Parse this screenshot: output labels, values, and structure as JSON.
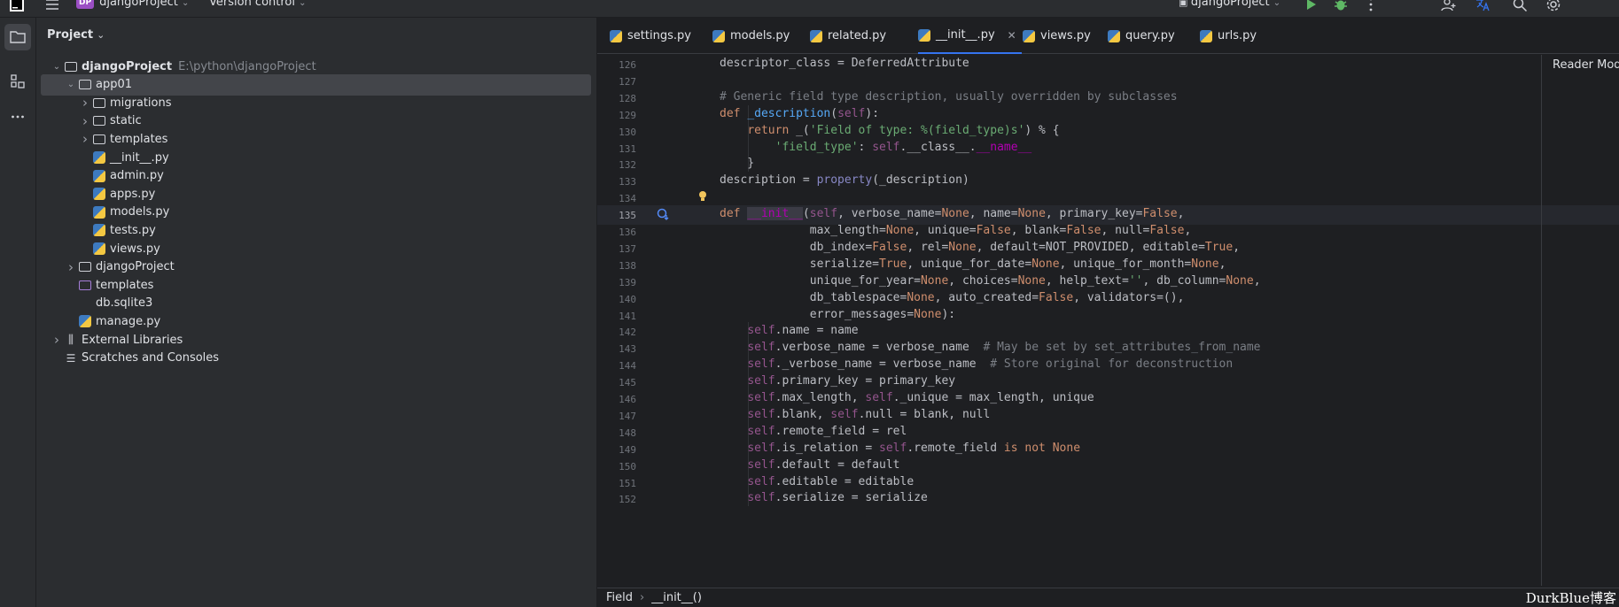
{
  "titlebar": {
    "project_badge": "DP",
    "project_name": "djangoProject",
    "version_control": "Version control",
    "run_target": "djangoProject"
  },
  "project_panel": {
    "title": "Project",
    "tree": [
      {
        "label": "djangoProject",
        "path": "E:\\python\\djangoProject",
        "type": "folder",
        "expanded": true
      },
      {
        "label": "app01",
        "type": "module-folder",
        "expanded": true,
        "selected": true
      },
      {
        "label": "migrations",
        "type": "module-folder",
        "expanded": false
      },
      {
        "label": "static",
        "type": "folder",
        "expanded": false
      },
      {
        "label": "templates",
        "type": "folder",
        "expanded": false
      },
      {
        "label": "__init__.py",
        "type": "python-file"
      },
      {
        "label": "admin.py",
        "type": "python-file"
      },
      {
        "label": "apps.py",
        "type": "python-file"
      },
      {
        "label": "models.py",
        "type": "python-file"
      },
      {
        "label": "tests.py",
        "type": "python-file"
      },
      {
        "label": "views.py",
        "type": "python-file"
      },
      {
        "label": "djangoProject",
        "type": "module-folder",
        "expanded": false
      },
      {
        "label": "templates",
        "type": "purple-folder"
      },
      {
        "label": "db.sqlite3",
        "type": "file"
      },
      {
        "label": "manage.py",
        "type": "python-file"
      },
      {
        "label": "External Libraries",
        "type": "library",
        "expanded": false
      },
      {
        "label": "Scratches and Consoles",
        "type": "scratches"
      }
    ]
  },
  "tabs": [
    {
      "label": "settings.py",
      "active": false
    },
    {
      "label": "models.py",
      "active": false
    },
    {
      "label": "related.py",
      "active": false
    },
    {
      "label": "__init__.py",
      "active": true
    },
    {
      "label": "views.py",
      "active": false
    },
    {
      "label": "query.py",
      "active": false
    },
    {
      "label": "urls.py",
      "active": false
    }
  ],
  "editor": {
    "reader_mode": "Reader Mode",
    "current_line": 135,
    "lines": [
      {
        "n": 126,
        "text": "descriptor_class = DeferredAttribute"
      },
      {
        "n": 127,
        "text": ""
      },
      {
        "n": 128,
        "text": "# Generic field type description, usually overridden by subclasses"
      },
      {
        "n": 129,
        "text": "def _description(self):"
      },
      {
        "n": 130,
        "text": "    return _('Field of type: %(field_type)s') % {"
      },
      {
        "n": 131,
        "text": "        'field_type': self.__class__.__name__"
      },
      {
        "n": 132,
        "text": "    }"
      },
      {
        "n": 133,
        "text": "description = property(_description)"
      },
      {
        "n": 134,
        "text": ""
      },
      {
        "n": 135,
        "text": "def __init__(self, verbose_name=None, name=None, primary_key=False,"
      },
      {
        "n": 136,
        "text": "             max_length=None, unique=False, blank=False, null=False,"
      },
      {
        "n": 137,
        "text": "             db_index=False, rel=None, default=NOT_PROVIDED, editable=True,"
      },
      {
        "n": 138,
        "text": "             serialize=True, unique_for_date=None, unique_for_month=None,"
      },
      {
        "n": 139,
        "text": "             unique_for_year=None, choices=None, help_text='', db_column=None,"
      },
      {
        "n": 140,
        "text": "             db_tablespace=None, auto_created=False, validators=(),"
      },
      {
        "n": 141,
        "text": "             error_messages=None):"
      },
      {
        "n": 142,
        "text": "    self.name = name"
      },
      {
        "n": 143,
        "text": "    self.verbose_name = verbose_name  # May be set by set_attributes_from_name"
      },
      {
        "n": 144,
        "text": "    self._verbose_name = verbose_name  # Store original for deconstruction"
      },
      {
        "n": 145,
        "text": "    self.primary_key = primary_key"
      },
      {
        "n": 146,
        "text": "    self.max_length, self._unique = max_length, unique"
      },
      {
        "n": 147,
        "text": "    self.blank, self.null = blank, null"
      },
      {
        "n": 148,
        "text": "    self.remote_field = rel"
      },
      {
        "n": 149,
        "text": "    self.is_relation = self.remote_field is not None"
      },
      {
        "n": 150,
        "text": "    self.default = default"
      },
      {
        "n": 151,
        "text": "    self.editable = editable"
      },
      {
        "n": 152,
        "text": "    self.serialize = serialize"
      }
    ]
  },
  "breadcrumb": {
    "items": [
      "Field",
      "__init__()"
    ]
  },
  "watermark": "DurkBlue博客",
  "colors": {
    "accent": "#3574f0",
    "keyword": "#cf8e6d",
    "comment": "#7a7e85",
    "string": "#6aab73",
    "self": "#94558d",
    "function": "#56a8f5",
    "dunder": "#b200b2"
  }
}
